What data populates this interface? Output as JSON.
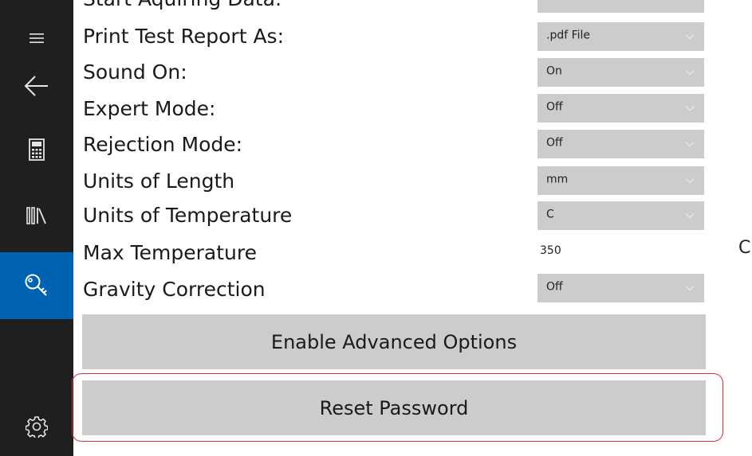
{
  "sidebar": {
    "items": [
      {
        "icon": "hamburger-menu-icon"
      },
      {
        "icon": "back-arrow-icon"
      },
      {
        "icon": "calculator-icon"
      },
      {
        "icon": "library-icon"
      },
      {
        "icon": "key-icon",
        "active": true
      },
      {
        "icon": "gear-icon"
      }
    ],
    "active_color": "#0063b1",
    "background": "#1f1f1f"
  },
  "settings": {
    "partial_label": "Start Aquiring Data:",
    "print_report": {
      "label": "Print Test Report As:",
      "value": ".pdf File"
    },
    "sound": {
      "label": "Sound On:",
      "value": "On"
    },
    "expert": {
      "label": "Expert Mode:",
      "value": "Off"
    },
    "rejection": {
      "label": "Rejection Mode:",
      "value": "Off"
    },
    "units_length": {
      "label": "Units of Length",
      "value": "mm"
    },
    "units_temp": {
      "label": "Units of Temperature",
      "value": "C"
    },
    "max_temp": {
      "label": "Max Temperature",
      "value": "350",
      "unit": "C"
    },
    "gravity": {
      "label": "Gravity Correction",
      "value": "Off"
    }
  },
  "buttons": {
    "advanced": "Enable Advanced Options",
    "reset": "Reset Password"
  },
  "colors": {
    "highlight": "#d9303a",
    "control_bg": "#cccccc"
  }
}
